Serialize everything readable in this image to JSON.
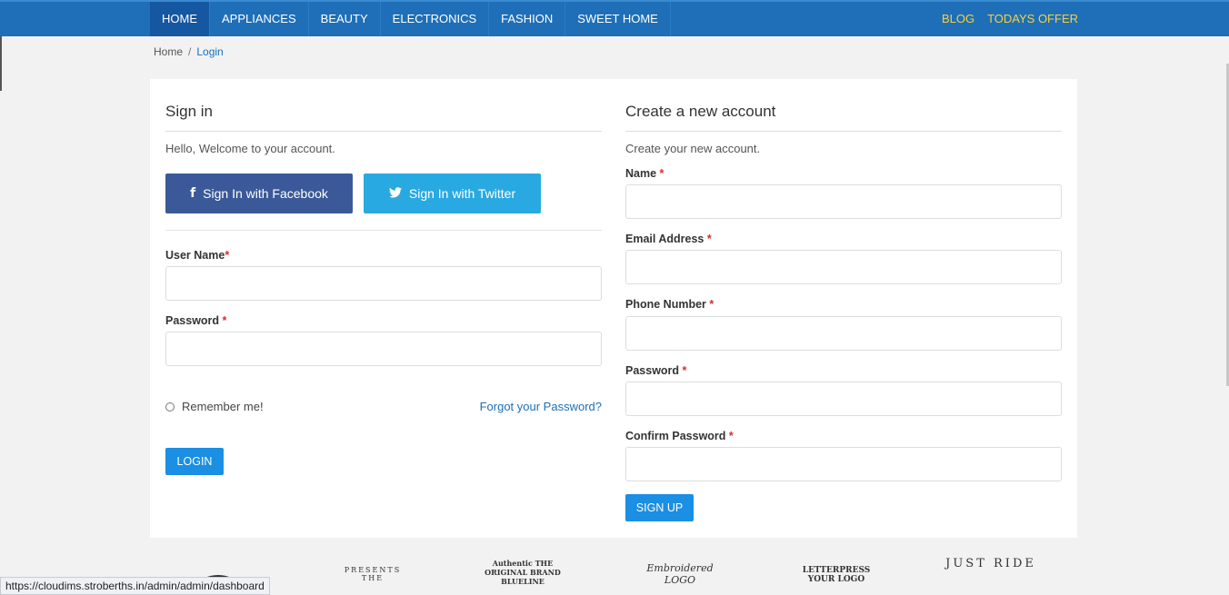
{
  "nav": {
    "items": [
      "HOME",
      "APPLIANCES",
      "BEAUTY",
      "ELECTRONICS",
      "FASHION",
      "SWEET HOME"
    ],
    "right": [
      "BLOG",
      "TODAYS OFFER"
    ]
  },
  "breadcrumb": {
    "home": "Home",
    "separator": "/",
    "current": "Login"
  },
  "signin": {
    "title": "Sign in",
    "intro": "Hello, Welcome to your account.",
    "facebook": "Sign In with Facebook",
    "twitter": "Sign In with Twitter",
    "username_label": "User Name",
    "password_label": "Password",
    "required_mark": "*",
    "remember": "Remember me!",
    "forgot": "Forgot your Password?",
    "login": "LOGIN"
  },
  "signup": {
    "title": "Create a new account",
    "intro": "Create your new account.",
    "fields": [
      {
        "label": "Name"
      },
      {
        "label": "Email Address"
      },
      {
        "label": "Phone Number"
      },
      {
        "label": "Password"
      },
      {
        "label": "Confirm Password"
      }
    ],
    "required_mark": "*",
    "submit": "SIGN UP"
  },
  "brand_logos": [
    "PRESENTS THE",
    "Authentic THE ORIGINAL BRAND BLUELINE",
    "Embroidered LOGO",
    "LETTERPRESS YOUR LOGO",
    "JUST RIDE"
  ],
  "status_url": "https://cloudims.stroberths.in/admin/admin/dashboard",
  "colors": {
    "nav_bg": "#1e6fb8",
    "accent": "#1a8fe3",
    "facebook": "#3b5998",
    "twitter": "#29a9e1",
    "required": "#d62d2d",
    "nav_right": "#f5d142"
  }
}
